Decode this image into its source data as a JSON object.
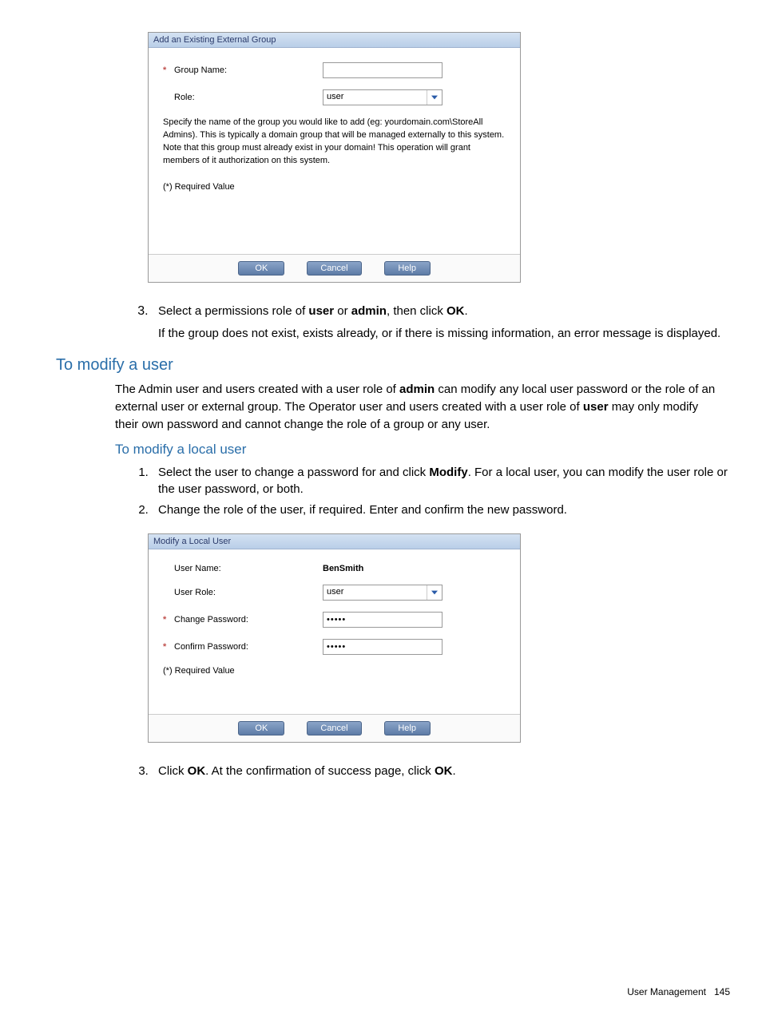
{
  "dialog1": {
    "title": "Add an Existing External Group",
    "group_name_label": "Group Name:",
    "role_label": "Role:",
    "role_value": "user",
    "help_text": "Specify the name of the group you would like to add (eg: yourdomain.com\\StoreAll Admins). This is typically a domain group that will be managed externally to this system. Note that this group must already exist in your domain! This operation will grant members of it authorization on this system.",
    "required_note": "(*) Required Value",
    "ok": "OK",
    "cancel": "Cancel",
    "help": "Help"
  },
  "step3a_text_1": "Select a permissions role of ",
  "step3a_user": "user",
  "step3a_or": " or ",
  "step3a_admin": "admin",
  "step3a_text_2": ", then click ",
  "step3a_ok": "OK",
  "step3a_text_3": ".",
  "step3a_sub": "If the group does not exist, exists already, or if there is missing information, an error message is displayed.",
  "heading_modify_user": "To modify a user",
  "modify_user_body_1": "The Admin user and users created with a user role of ",
  "modify_user_admin": "admin",
  "modify_user_body_2": " can modify any local user password or the role of an external user or external group. The Operator user and users created with a user role of ",
  "modify_user_user": "user",
  "modify_user_body_3": " may only modify their own password and cannot change the role of a group or any user.",
  "heading_modify_local": "To modify a local user",
  "step1_text_1": "Select the user to change a password for and click ",
  "step1_modify": "Modify",
  "step1_text_2": ". For a local user, you can modify the user role or the user password, or both.",
  "step2_text": "Change the role of the user, if required. Enter and confirm the new password.",
  "dialog2": {
    "title": "Modify a Local User",
    "user_name_label": "User Name:",
    "user_name_value": "BenSmith",
    "user_role_label": "User Role:",
    "user_role_value": "user",
    "change_pwd_label": "Change Password:",
    "confirm_pwd_label": "Confirm Password:",
    "pwd_value": "•••••",
    "required_note": "(*) Required Value",
    "ok": "OK",
    "cancel": "Cancel",
    "help": "Help"
  },
  "step3b_text_1": "Click ",
  "step3b_ok": "OK",
  "step3b_text_2": ". At the confirmation of success page, click ",
  "step3b_ok2": "OK",
  "step3b_text_3": ".",
  "footer_label": "User Management",
  "footer_page": "145"
}
